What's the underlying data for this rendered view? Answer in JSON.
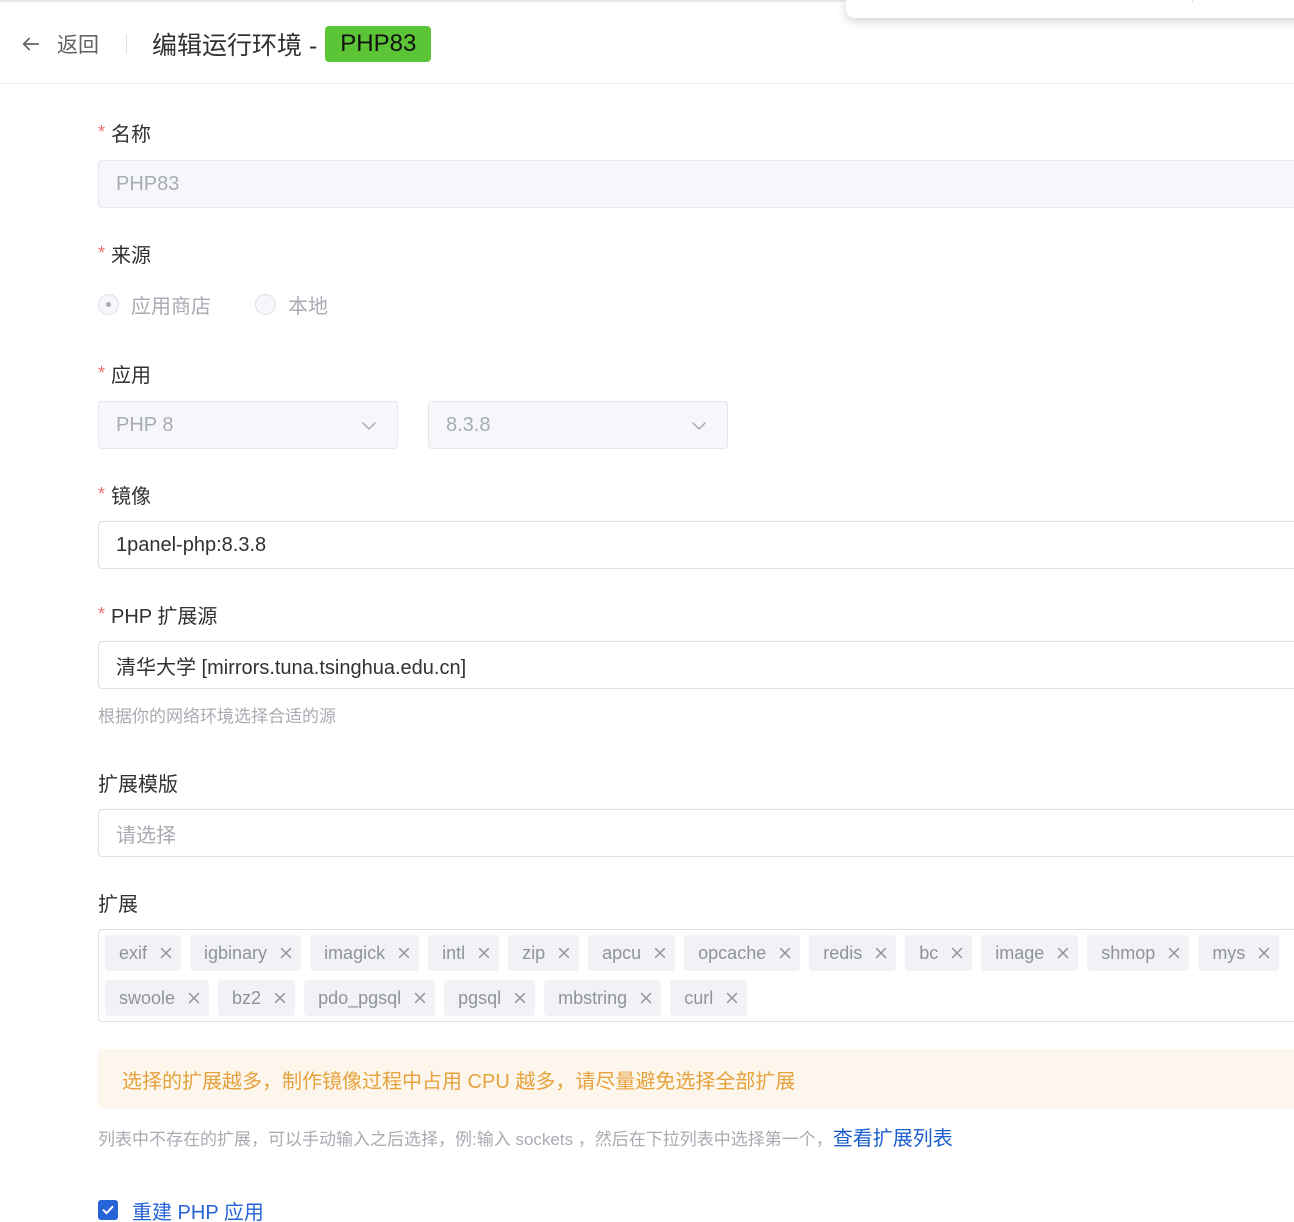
{
  "header": {
    "back_label": "返回",
    "title": "编辑运行环境 -",
    "tag": "PHP83"
  },
  "form": {
    "name": {
      "label": "名称",
      "value": "PHP83"
    },
    "source": {
      "label": "来源",
      "options": [
        "应用商店",
        "本地"
      ],
      "selected": "应用商店"
    },
    "app": {
      "label": "应用",
      "app_value": "PHP 8",
      "version_value": "8.3.8"
    },
    "image": {
      "label": "镜像",
      "value": "1panel-php:8.3.8"
    },
    "ext_source": {
      "label": "PHP 扩展源",
      "value": "清华大学 [mirrors.tuna.tsinghua.edu.cn]",
      "hint": "根据你的网络环境选择合适的源"
    },
    "ext_template": {
      "label": "扩展模版",
      "placeholder": "请选择"
    },
    "extensions": {
      "label": "扩展",
      "row1": [
        "exif",
        "igbinary",
        "imagick",
        "intl",
        "zip",
        "apcu",
        "opcache",
        "redis",
        "bc",
        "image",
        "shmop",
        "mys"
      ],
      "row2": [
        "swoole",
        "bz2",
        "pdo_pgsql",
        "pgsql",
        "mbstring",
        "curl"
      ]
    },
    "warning": "选择的扩展越多，制作镜像过程中占用 CPU 越多，请尽量避免选择全部扩展",
    "ext_hint": "列表中不存在的扩展，可以手动输入之后选择，例:输入 sockets ，然后在下拉列表中选择第一个，",
    "ext_link": "查看扩展列表",
    "rebuild": {
      "label": "重建 PHP 应用",
      "checked": true
    }
  },
  "colors": {
    "tag_green": "#5cc437",
    "required": "#f56c6c",
    "warning_text": "#e6a23c",
    "warning_bg": "#fdf6ec",
    "primary": "#2563d6"
  },
  "icons": [
    "arrow-left-icon",
    "chevron-down-icon",
    "close-icon",
    "check-icon"
  ]
}
